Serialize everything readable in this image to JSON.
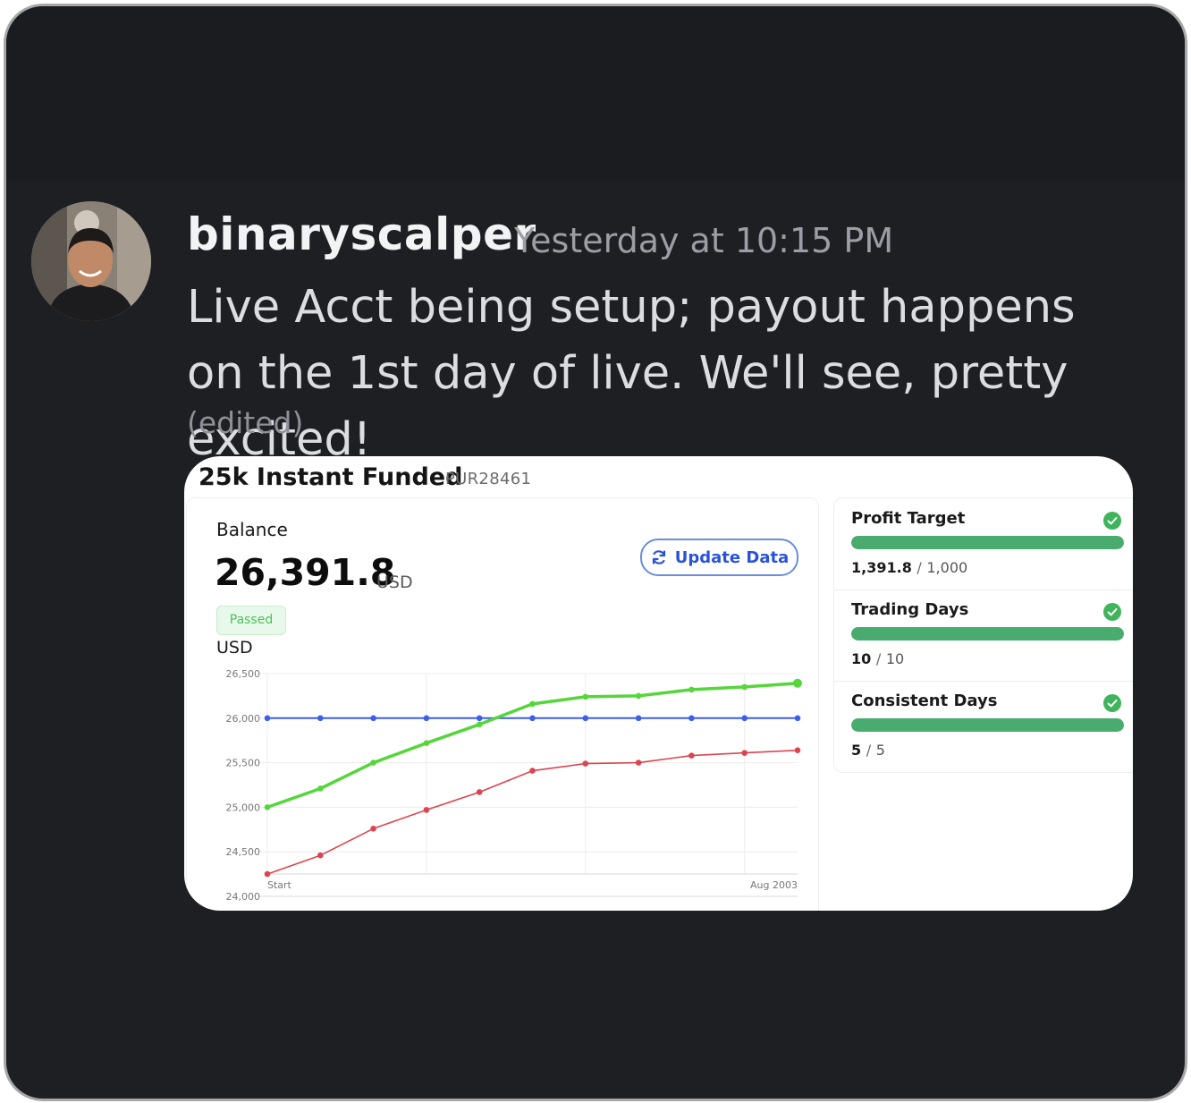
{
  "message": {
    "username": "binaryscalper",
    "timestamp": "Yesterday at 10:15 PM",
    "text": "Live Acct being setup; payout happens on the 1st day of live. We'll see, pretty excited!",
    "edited_label": "(edited)"
  },
  "card": {
    "title": "25k Instant Funded",
    "account_id": "PUR28461",
    "balance_label": "Balance",
    "balance_value": "26,391.8",
    "balance_unit": "USD",
    "status_badge": "Passed",
    "update_button_label": "Update Data",
    "update_icon": "refresh-icon",
    "chart_unit_label": "USD",
    "targets": [
      {
        "label": "Profit Target",
        "current": "1,391.8",
        "separator": "/",
        "total": "1,000",
        "progress": 1.0,
        "icon": "check-circle-icon"
      },
      {
        "label": "Trading Days",
        "current": "10",
        "separator": "/",
        "total": "10",
        "progress": 1.0,
        "icon": "check-circle-icon"
      },
      {
        "label": "Consistent Days",
        "current": "5",
        "separator": "/",
        "total": "5",
        "progress": 1.0,
        "icon": "check-circle-icon"
      }
    ]
  },
  "colors": {
    "background": "#1e1f23",
    "username": "#f2f3f5",
    "accent_blue": "#2952d9",
    "success_green": "#3fb45c"
  },
  "chart_data": {
    "type": "line",
    "y_ticks": [
      "26,500",
      "26,000",
      "25,500",
      "25,000",
      "24,500",
      "24,000"
    ],
    "x_tick_labels": [
      "Start",
      "Aug 2003"
    ],
    "ylim": [
      24000,
      26500
    ],
    "grid": true,
    "x": [
      0,
      1,
      2,
      3,
      4,
      5,
      6,
      7,
      8,
      9,
      10
    ],
    "series": [
      {
        "color": "#55d63b",
        "values": [
          25000,
          25210,
          25500,
          25720,
          25930,
          26160,
          26240,
          26250,
          26320,
          26350,
          26392
        ]
      },
      {
        "color": "#3d5ee8",
        "values": [
          26000,
          26000,
          26000,
          26000,
          26000,
          26000,
          26000,
          26000,
          26000,
          26000,
          26000
        ]
      },
      {
        "color": "#dc4450",
        "values": [
          24250,
          24460,
          24760,
          24970,
          25170,
          25410,
          25490,
          25500,
          25580,
          25610,
          25640
        ]
      }
    ]
  }
}
